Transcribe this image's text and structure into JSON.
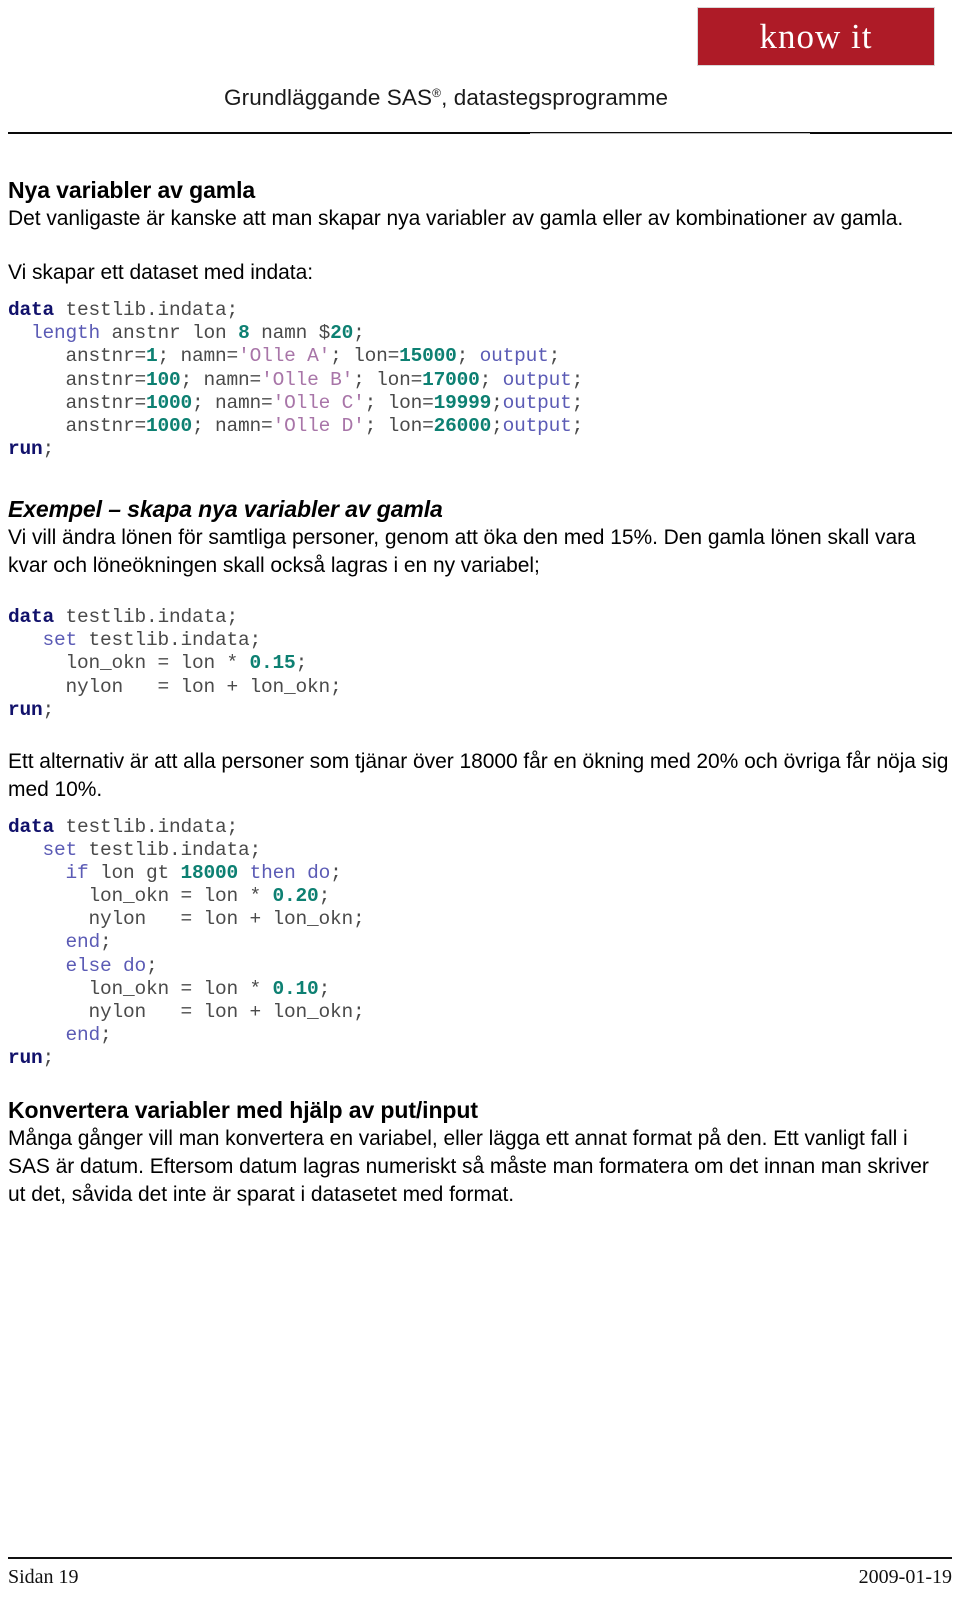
{
  "header": {
    "logo_text": "know it",
    "logo_color": "#AE1B27",
    "title_main": "Grundläggande SAS",
    "title_reg": "®",
    "title_rest": ", datastegsprogramme"
  },
  "sections": {
    "s1_heading": "Nya variabler av gamla",
    "s1_para": "Det vanligaste är kanske att man skapar nya variabler av gamla eller av kombinationer av gamla.",
    "s1_intro": "Vi skapar ett dataset med indata:",
    "s2_heading": "Exempel – skapa nya variabler av gamla",
    "s2_para": "Vi vill ändra lönen för samtliga personer, genom att öka den med 15%. Den gamla lönen skall vara kvar och löneökningen skall också lagras i en ny variabel;",
    "s3_para": "Ett alternativ är att alla personer som tjänar över 18000 får en ökning med 20% och övriga får nöja sig med 10%.",
    "s4_heading": "Konvertera variabler med hjälp av put/input",
    "s4_para": "Många gånger vill man konvertera en variabel, eller lägga ett annat format på den. Ett vanligt fall i SAS är datum. Eftersom datum lagras numeriskt så måste man formatera om det innan man skriver ut det, såvida det inte är sparat i datasetet med format."
  },
  "code_blocks": {
    "block1_title": "create-indata-dataset",
    "block1_lines": [
      "data testlib.indata;",
      "  length anstnr lon 8 namn $20;",
      "     anstnr=1; namn='Olle A'; lon=15000; output;",
      "     anstnr=100; namn='Olle B'; lon=17000; output;",
      "     anstnr=1000; namn='Olle C'; lon=19999;output;",
      "     anstnr=1000; namn='Olle D'; lon=26000;output;",
      "run;"
    ],
    "block2_title": "flat-15-percent-raise",
    "block2_lines": [
      "data testlib.indata;",
      "   set testlib.indata;",
      "     lon_okn = lon * 0.15;",
      "     nylon   = lon + lon_okn;",
      "run;"
    ],
    "block3_title": "conditional-raise",
    "block3_lines": [
      "data testlib.indata;",
      "   set testlib.indata;",
      "     if lon gt 18000 then do;",
      "       lon_okn = lon * 0.20;",
      "       nylon   = lon + lon_okn;",
      "     end;",
      "     else do;",
      "       lon_okn = lon * 0.10;",
      "       nylon   = lon + lon_okn;",
      "     end;",
      "run;"
    ]
  },
  "syntax_colors": {
    "keyword_data": "#11116b",
    "keyword_statement": "#5b5bb5",
    "number_literal": "#0d8072",
    "string_literal": "#a875a8",
    "plain_text": "#4a4a4a"
  },
  "footer": {
    "page_label": "Sidan 19",
    "date": "2009-01-19"
  }
}
